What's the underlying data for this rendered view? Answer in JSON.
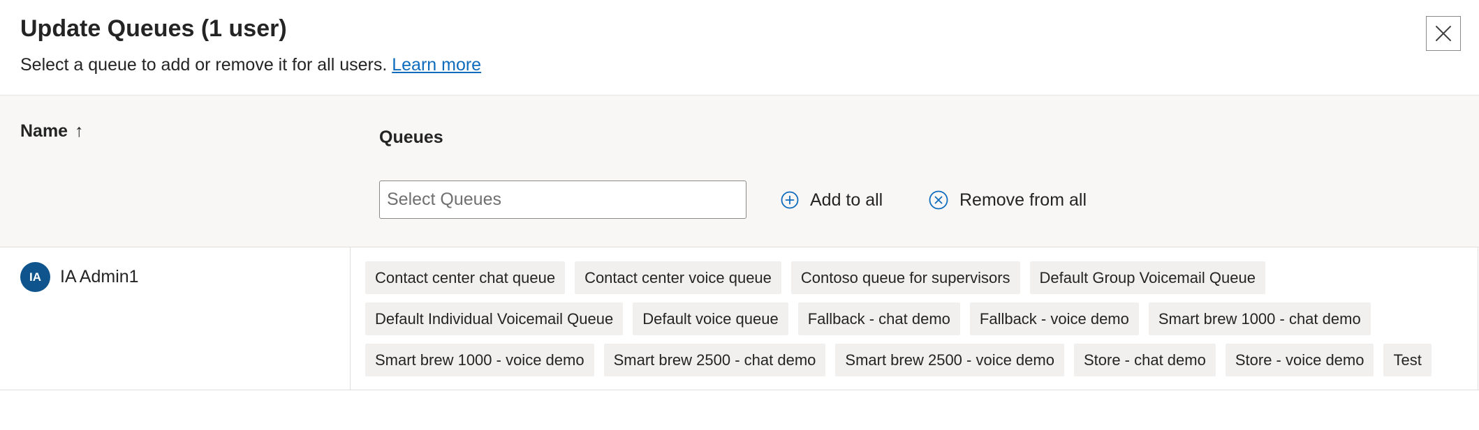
{
  "dialog": {
    "title": "Update Queues (1 user)",
    "subtitle": "Select a queue to add or remove it for all users.",
    "learn_more": "Learn more"
  },
  "columns": {
    "name": "Name",
    "name_sort_indicator": "↑",
    "queues": "Queues"
  },
  "queue_select": {
    "placeholder": "Select Queues",
    "value": ""
  },
  "actions": {
    "add_to_all": "Add to all",
    "remove_from_all": "Remove from all"
  },
  "users": [
    {
      "initials": "IA",
      "name": "IA Admin1",
      "queues": [
        "Contact center chat queue",
        "Contact center voice queue",
        "Contoso queue for supervisors",
        "Default Group Voicemail Queue",
        "Default Individual Voicemail Queue",
        "Default voice queue",
        "Fallback - chat demo",
        "Fallback - voice demo",
        "Smart brew 1000 - chat demo",
        "Smart brew 1000 - voice demo",
        "Smart brew 2500 - chat demo",
        "Smart brew 2500 - voice demo",
        "Store - chat demo",
        "Store - voice demo",
        "Test"
      ]
    }
  ],
  "icons": {
    "close": "close-icon",
    "add": "add-circle-icon",
    "remove": "dismiss-circle-icon",
    "sort": "arrow-up-icon"
  },
  "colors": {
    "accent": "#0f6cbd",
    "avatar_bg": "#0f548c",
    "header_band": "#f8f7f6",
    "tag_bg": "#f1f0ef"
  }
}
